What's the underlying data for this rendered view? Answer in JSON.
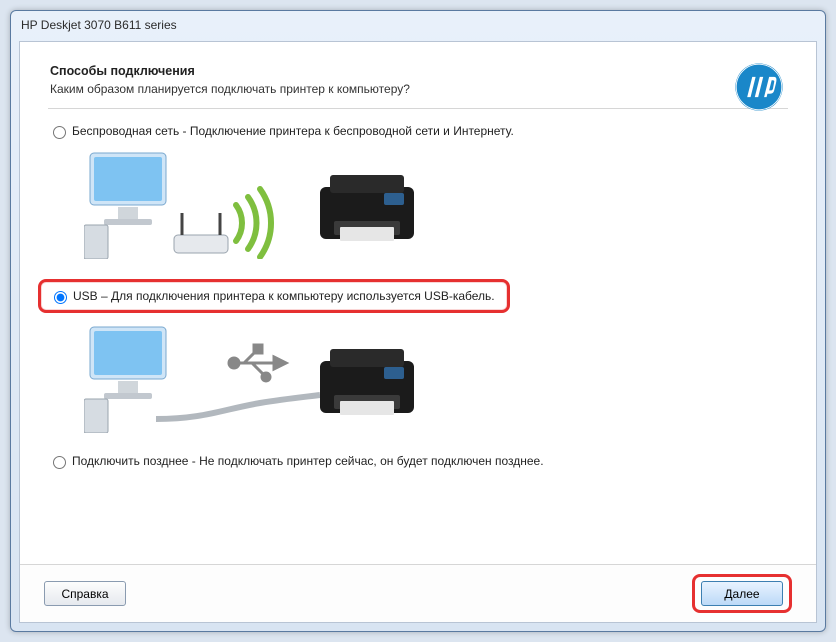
{
  "window": {
    "title": "HP Deskjet 3070 B611 series"
  },
  "header": {
    "title": "Способы подключения",
    "subtitle": "Каким образом планируется подключать принтер к компьютеру?"
  },
  "options": {
    "wireless": {
      "label": "Беспроводная сеть - Подключение принтера к беспроводной сети и Интернету."
    },
    "usb": {
      "label": "USB – Для подключения принтера к компьютеру используется USB-кабель."
    },
    "later": {
      "label": "Подключить позднее - Не подключать принтер сейчас, он будет подключен  позднее."
    }
  },
  "footer": {
    "help": "Справка",
    "next": "Далее"
  }
}
